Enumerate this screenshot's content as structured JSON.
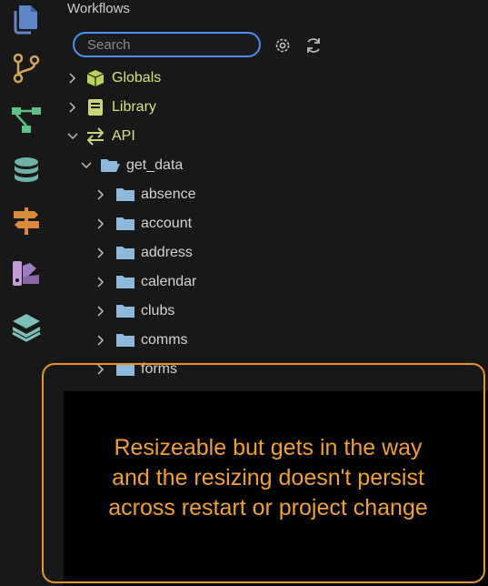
{
  "sidebar": {
    "title": "Workflows",
    "search": {
      "placeholder": "Search",
      "value": ""
    },
    "tools": [
      "gear-icon",
      "refresh-icon"
    ]
  },
  "activity_bar": {
    "icons": [
      "files-icon",
      "source-control-icon",
      "workflow-tree-icon",
      "database-icon",
      "signpost-icon",
      "palette-icon",
      "layers-icon"
    ]
  },
  "tree": {
    "globals": "Globals",
    "library": "Library",
    "api": "API",
    "get_data": "get_data",
    "folders": [
      "absence",
      "account",
      "address",
      "calendar",
      "clubs",
      "comms",
      "forms"
    ]
  },
  "colors": {
    "search_border": "#4a8ef0",
    "tree_label_accent": "#d8e27a",
    "folder_icon": "#8fb9dc",
    "callout": "#e8942c"
  },
  "annotation": {
    "lines": [
      "Resizeable but gets in the way",
      "and the resizing doesn't persist",
      "across restart or project change"
    ]
  }
}
